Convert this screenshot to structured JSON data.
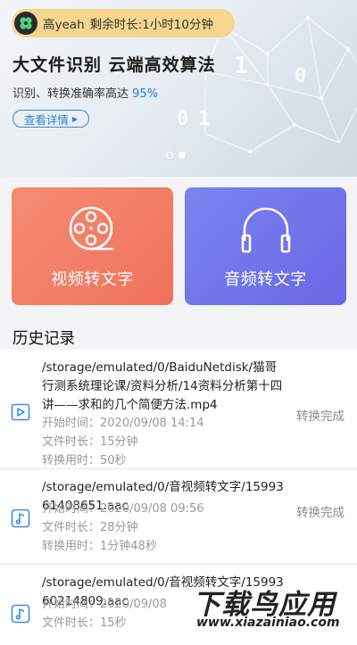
{
  "banner": {
    "user_name": "高yeah",
    "remaining_time": "剩余时长:1小时10分钟",
    "headline": "大文件识别 云端高效算法",
    "subline_text": "识别、转换准确率高达",
    "subline_highlight": "95%",
    "detail_button": "查看详情",
    "deco_digits": [
      "1",
      "0",
      "0",
      "1"
    ],
    "pager": {
      "count": 2,
      "active": 2
    }
  },
  "cards": {
    "video_label": "视频转文字",
    "audio_label": "音频转文字"
  },
  "history": {
    "title": "历史记录",
    "items": [
      {
        "type": "video",
        "path": "/storage/emulated/0/BaiduNetdisk/猫哥行测系统理论课/资料分析/14资料分析第十四讲——求和的几个简便方法.mp4",
        "start_time": "开始时间：2020/09/08 14:14",
        "duration": "文件时长：15分钟",
        "elapsed": "转换用时：50秒",
        "status": "转换完成"
      },
      {
        "type": "audio",
        "path": "/storage/emulated/0/音视频转文字/1599361408651.aac",
        "start_time": "开始时间：2020/09/08 09:56",
        "duration": "文件时长：28分钟",
        "elapsed": "转换用时：1分钟48秒",
        "status": "转换完成"
      },
      {
        "type": "audio",
        "path": "/storage/emulated/0/音视频转文字/1599360214809.aac",
        "start_time": "开始时间：2020/09/08",
        "duration": "文件时长：15秒",
        "elapsed": "",
        "status": ""
      }
    ]
  },
  "watermark": {
    "main": "下载鸟应用",
    "sub": "www.xiazainiao.com"
  },
  "colors": {
    "video_card": "#f0715c",
    "audio_card": "#6a66e6",
    "accent_blue": "#1c7fe3",
    "pill": "#f6d68f"
  },
  "icons": {
    "avatar": "clover-avatar-icon",
    "video_card": "film-reel-icon",
    "audio_card": "headphones-icon",
    "video_item": "video-file-icon",
    "audio_item": "music-note-icon"
  }
}
